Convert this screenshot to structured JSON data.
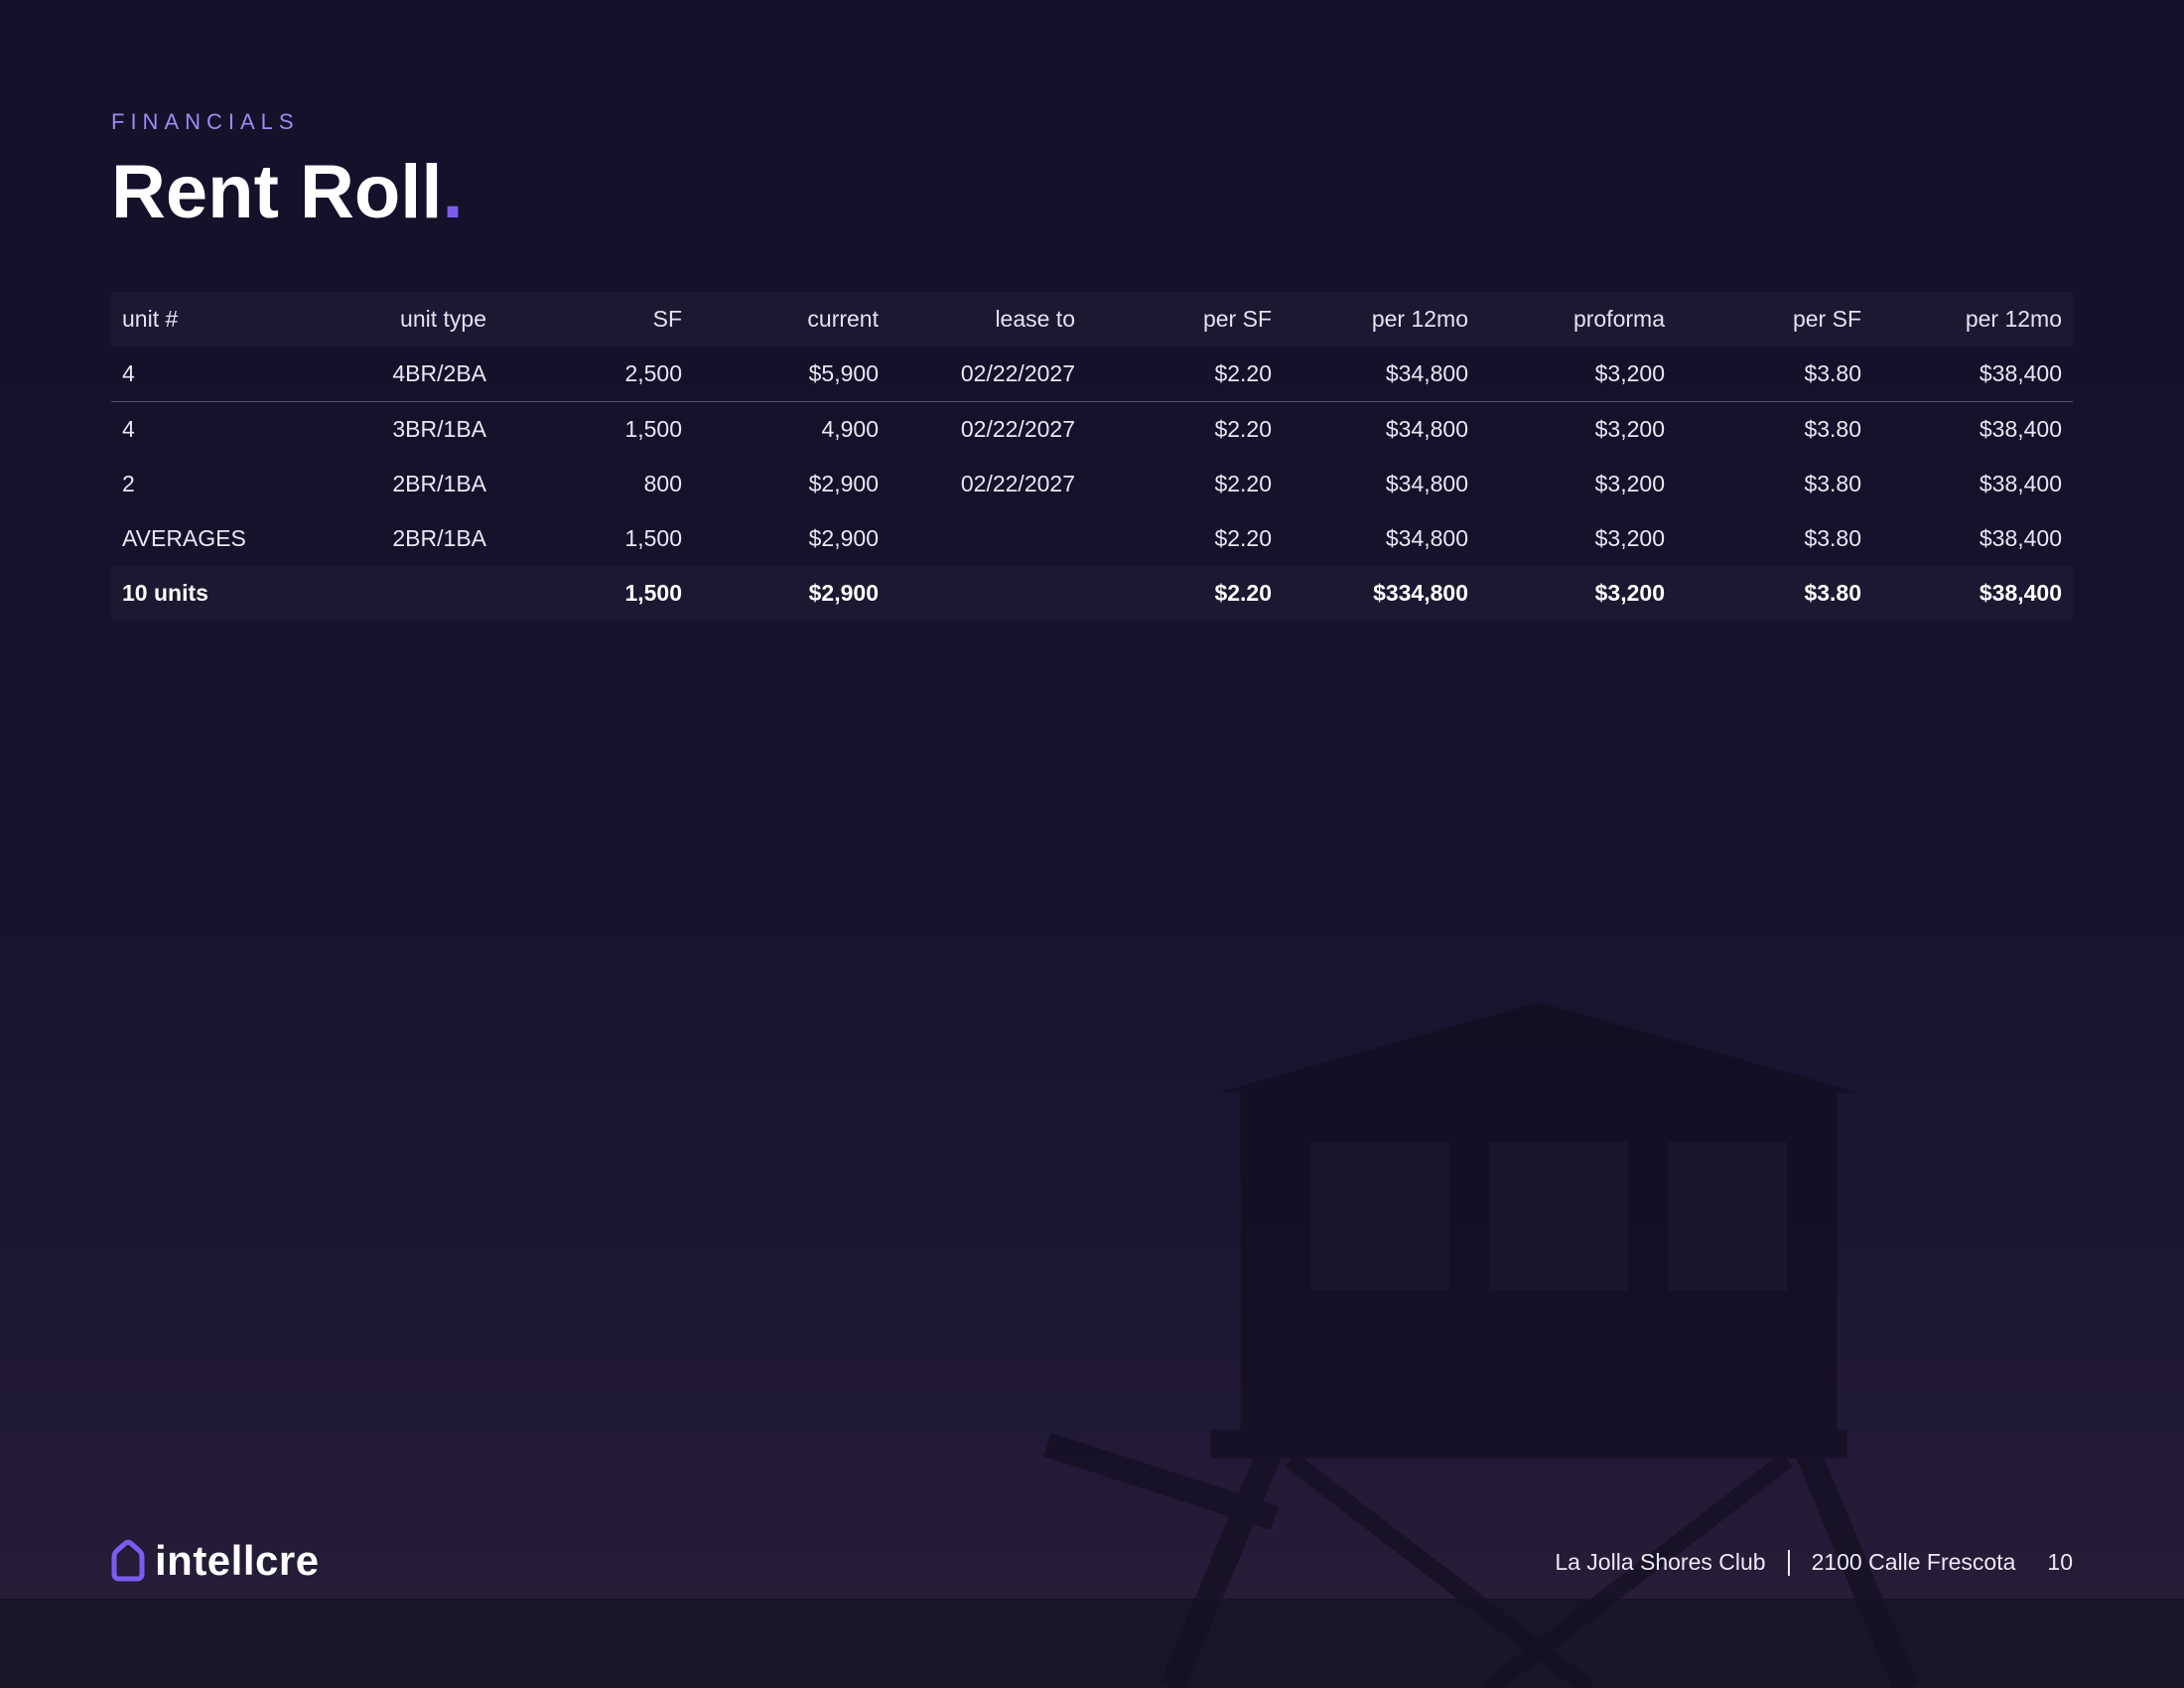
{
  "header": {
    "eyebrow": "FINANCIALS",
    "title": "Rent Roll",
    "title_dot": "."
  },
  "table": {
    "columns": [
      "unit #",
      "unit type",
      "SF",
      "current",
      "lease to",
      "per SF",
      "per 12mo",
      "proforma",
      "per SF",
      "per 12mo"
    ],
    "rows": [
      [
        "4",
        "4BR/2BA",
        "2,500",
        "$5,900",
        "02/22/2027",
        "$2.20",
        "$34,800",
        "$3,200",
        "$3.80",
        "$38,400"
      ],
      [
        "4",
        "3BR/1BA",
        "1,500",
        "4,900",
        "02/22/2027",
        "$2.20",
        "$34,800",
        "$3,200",
        "$3.80",
        "$38,400"
      ],
      [
        "2",
        "2BR/1BA",
        "800",
        "$2,900",
        "02/22/2027",
        "$2.20",
        "$34,800",
        "$3,200",
        "$3.80",
        "$38,400"
      ],
      [
        "AVERAGES",
        "2BR/1BA",
        "1,500",
        "$2,900",
        "",
        "$2.20",
        "$34,800",
        "$3,200",
        "$3.80",
        "$38,400"
      ]
    ],
    "total": [
      "10 units",
      "",
      "1,500",
      "$2,900",
      "",
      "$2.20",
      "$334,800",
      "$3,200",
      "$3.80",
      "$38,400"
    ]
  },
  "footer": {
    "brand": "intellcre",
    "property_name": "La Jolla Shores Club",
    "address": "2100 Calle Frescota",
    "page_number": "10"
  },
  "colors": {
    "background": "#15122a",
    "accent": "#7b5cf0",
    "eyebrow": "#9d8cf0",
    "row_band": "#1b1831"
  },
  "icons": {
    "logo": "house-outline-icon"
  }
}
